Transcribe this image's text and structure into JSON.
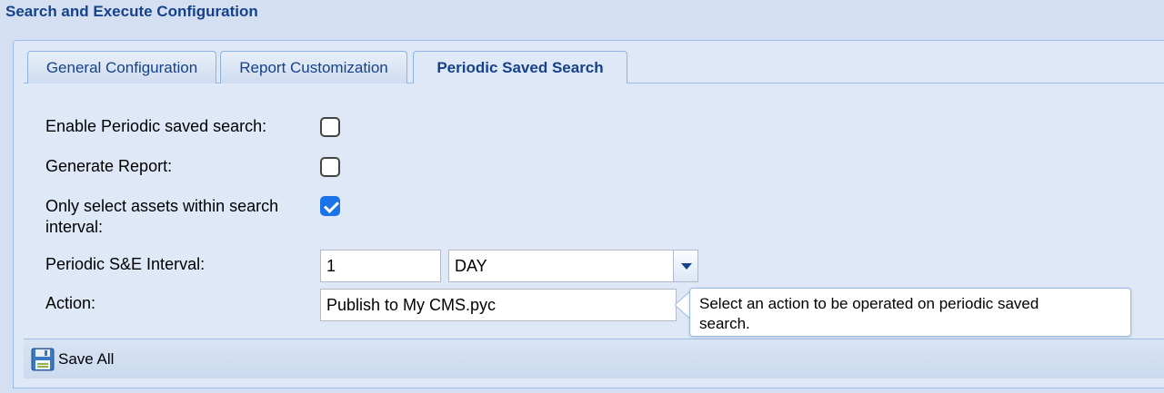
{
  "panel": {
    "title": "Search and Execute Configuration"
  },
  "tabs": [
    {
      "label": "General Configuration",
      "active": false
    },
    {
      "label": "Report Customization",
      "active": false
    },
    {
      "label": "Periodic Saved Search",
      "active": true
    }
  ],
  "form": {
    "enable_periodic": {
      "label": "Enable Periodic saved search:",
      "checked": false
    },
    "generate_report": {
      "label": "Generate Report:",
      "checked": false
    },
    "only_select_assets": {
      "label_line1": "Only select assets within search",
      "label_line2": "interval:",
      "checked": true
    },
    "interval": {
      "label": "Periodic S&E Interval:",
      "value": "1",
      "unit": "DAY"
    },
    "action": {
      "label": "Action:",
      "value": "Publish to My CMS.pyc"
    }
  },
  "tooltip": {
    "line1": "Select an action to be operated on periodic saved",
    "line2": "search."
  },
  "toolbar": {
    "save_label": "Save All",
    "save_icon": "floppy-disk-icon"
  }
}
